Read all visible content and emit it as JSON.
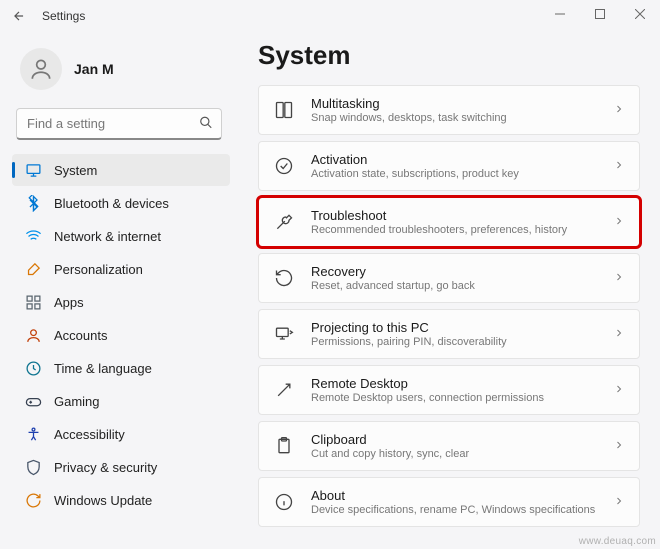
{
  "window": {
    "title": "Settings"
  },
  "user": {
    "name": "Jan M"
  },
  "search": {
    "placeholder": "Find a setting"
  },
  "nav": [
    {
      "id": "system",
      "label": "System",
      "active": true,
      "icon": "system"
    },
    {
      "id": "bluetooth",
      "label": "Bluetooth & devices",
      "icon": "bluetooth"
    },
    {
      "id": "network",
      "label": "Network & internet",
      "icon": "wifi"
    },
    {
      "id": "personalization",
      "label": "Personalization",
      "icon": "brush"
    },
    {
      "id": "apps",
      "label": "Apps",
      "icon": "apps"
    },
    {
      "id": "accounts",
      "label": "Accounts",
      "icon": "account"
    },
    {
      "id": "time",
      "label": "Time & language",
      "icon": "time"
    },
    {
      "id": "gaming",
      "label": "Gaming",
      "icon": "gaming"
    },
    {
      "id": "accessibility",
      "label": "Accessibility",
      "icon": "accessibility"
    },
    {
      "id": "privacy",
      "label": "Privacy & security",
      "icon": "privacy"
    },
    {
      "id": "update",
      "label": "Windows Update",
      "icon": "update"
    }
  ],
  "page": {
    "title": "System"
  },
  "items": [
    {
      "id": "multitasking",
      "title": "Multitasking",
      "sub": "Snap windows, desktops, task switching",
      "icon": "multitask",
      "highlight": false
    },
    {
      "id": "activation",
      "title": "Activation",
      "sub": "Activation state, subscriptions, product key",
      "icon": "check",
      "highlight": false
    },
    {
      "id": "troubleshoot",
      "title": "Troubleshoot",
      "sub": "Recommended troubleshooters, preferences, history",
      "icon": "wrench",
      "highlight": true
    },
    {
      "id": "recovery",
      "title": "Recovery",
      "sub": "Reset, advanced startup, go back",
      "icon": "recovery",
      "highlight": false
    },
    {
      "id": "projecting",
      "title": "Projecting to this PC",
      "sub": "Permissions, pairing PIN, discoverability",
      "icon": "project",
      "highlight": false
    },
    {
      "id": "remote",
      "title": "Remote Desktop",
      "sub": "Remote Desktop users, connection permissions",
      "icon": "remote",
      "highlight": false
    },
    {
      "id": "clipboard",
      "title": "Clipboard",
      "sub": "Cut and copy history, sync, clear",
      "icon": "clipboard",
      "highlight": false
    },
    {
      "id": "about",
      "title": "About",
      "sub": "Device specifications, rename PC, Windows specifications",
      "icon": "info",
      "highlight": false
    }
  ],
  "watermark": "www.deuaq.com"
}
